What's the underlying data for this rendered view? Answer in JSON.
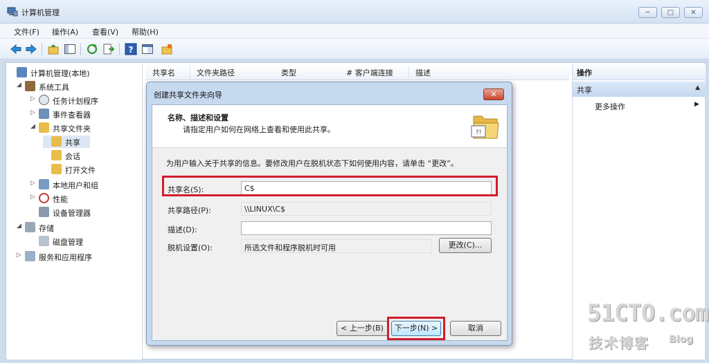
{
  "window": {
    "title": "计算机管理",
    "minimize": "─",
    "maximize": "□",
    "close": "✕"
  },
  "menu": [
    "文件(F)",
    "操作(A)",
    "查看(V)",
    "帮助(H)"
  ],
  "toolbar": {
    "icons": [
      "back-icon",
      "forward-icon",
      "up-folder-icon",
      "show-hide-tree-icon",
      "refresh-icon",
      "export-list-icon",
      "help-icon",
      "properties-icon",
      "new-share-icon"
    ]
  },
  "tree": [
    {
      "label": "计算机管理(本地)",
      "icon": "computer-management-icon",
      "arrow": ""
    },
    {
      "label": "系统工具",
      "icon": "system-tools-icon",
      "arrow": "◢"
    },
    {
      "label": "任务计划程序",
      "icon": "task-scheduler-icon",
      "arrow": "▷"
    },
    {
      "label": "事件查看器",
      "icon": "event-viewer-icon",
      "arrow": "▷"
    },
    {
      "label": "共享文件夹",
      "icon": "shared-folders-icon",
      "arrow": "◢"
    },
    {
      "label": "共享",
      "icon": "shares-icon",
      "arrow": ""
    },
    {
      "label": "会话",
      "icon": "sessions-icon",
      "arrow": ""
    },
    {
      "label": "打开文件",
      "icon": "open-files-icon",
      "arrow": ""
    },
    {
      "label": "本地用户和组",
      "icon": "local-users-groups-icon",
      "arrow": "▷"
    },
    {
      "label": "性能",
      "icon": "performance-icon",
      "arrow": "▷"
    },
    {
      "label": "设备管理器",
      "icon": "device-manager-icon",
      "arrow": ""
    },
    {
      "label": "存储",
      "icon": "storage-icon",
      "arrow": "◢"
    },
    {
      "label": "磁盘管理",
      "icon": "disk-management-icon",
      "arrow": ""
    },
    {
      "label": "服务和应用程序",
      "icon": "services-applications-icon",
      "arrow": "▷"
    }
  ],
  "list": {
    "columns": [
      "共享名",
      "文件夹路径",
      "类型",
      "# 客户端连接",
      "描述"
    ]
  },
  "actions": {
    "header": "操作",
    "group": "共享",
    "group_collapse": "▲",
    "item": "更多操作",
    "item_arrow": "▶"
  },
  "dialog": {
    "title": "创建共享文件夹向导",
    "close": "✕",
    "heading": "名称、描述和设置",
    "subheading": "请指定用户如何在网络上查看和使用此共享。",
    "description": "为用户输入关于共享的信息。要修改用户在脱机状态下如何使用内容，请单击 “更改”。",
    "share_name_label": "共享名(S):",
    "share_name_value": "C$",
    "share_path_label": "共享路径(P):",
    "share_path_value": "\\\\LINUX\\C$",
    "description_label": "描述(D):",
    "description_value": "",
    "offline_label": "脱机设置(O):",
    "offline_value": "所选文件和程序脱机时可用",
    "change_button": "更改(C)...",
    "back_button": "< 上一步(B)",
    "next_button": "下一步(N) >",
    "cancel_button": "取消"
  },
  "watermark": {
    "site": "51CTO.com",
    "tagline": "技术博客",
    "blog": "Blog"
  },
  "colors": {
    "highlight": "#d21d2b",
    "window_chrome": "#d4e2f3",
    "dialog_frame": "#c6d9ef"
  }
}
